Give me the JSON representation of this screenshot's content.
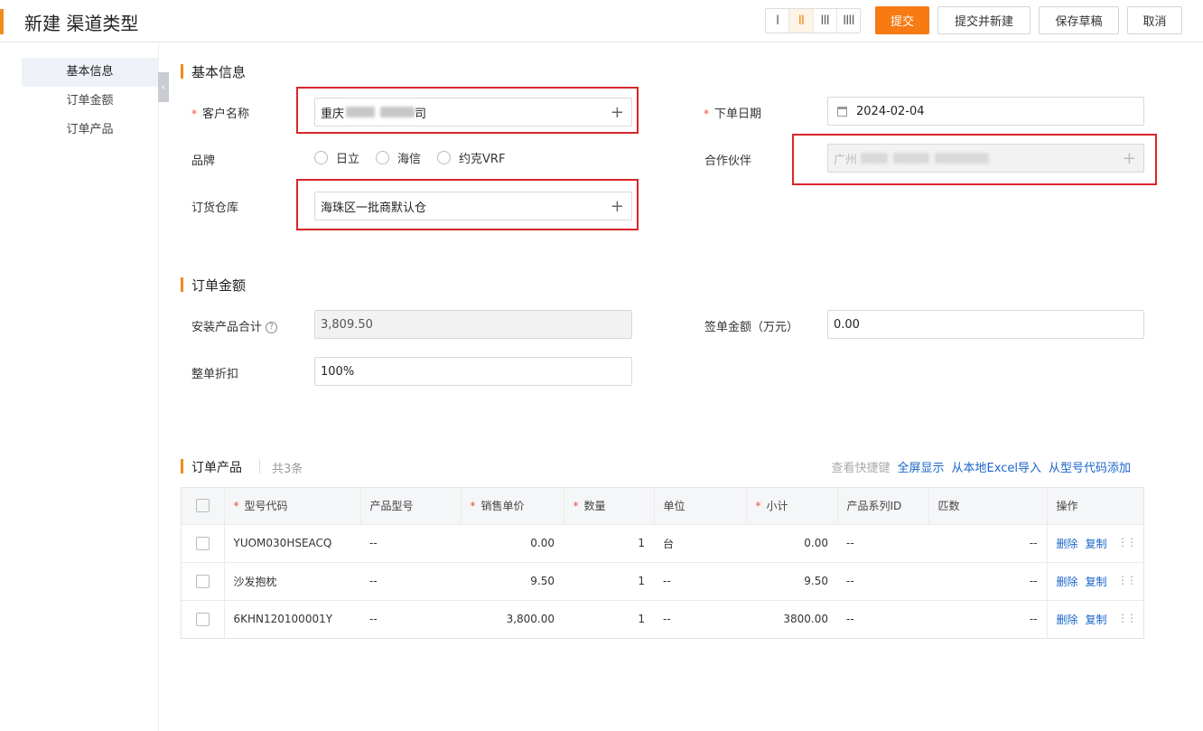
{
  "header": {
    "title": "新建 渠道类型",
    "layout_options": [
      "I",
      "II",
      "III",
      "IIII"
    ],
    "active_layout": 1,
    "buttons": {
      "submit": "提交",
      "submit_new": "提交并新建",
      "save_draft": "保存草稿",
      "cancel": "取消"
    }
  },
  "sidebar": {
    "items": [
      "基本信息",
      "订单金额",
      "订单产品"
    ],
    "active": 0
  },
  "basic": {
    "title": "基本信息",
    "customer": {
      "label": "客户名称",
      "value": "重庆",
      "value_tail": "司"
    },
    "order_date": {
      "label": "下单日期",
      "value": "2024-02-04"
    },
    "brand": {
      "label": "品牌",
      "options": [
        "日立",
        "海信",
        "约克VRF"
      ]
    },
    "partner": {
      "label": "合作伙伴",
      "value": "广州"
    },
    "warehouse": {
      "label": "订货仓库",
      "value": "海珠区一批商默认仓"
    }
  },
  "amount": {
    "title": "订单金额",
    "install_total": {
      "label": "安装产品合计",
      "value": "3,809.50"
    },
    "sign_amount": {
      "label": "签单金额（万元）",
      "value": "0.00"
    },
    "discount": {
      "label": "整单折扣",
      "value": "100%"
    }
  },
  "products": {
    "title": "订单产品",
    "count": "共3条",
    "links": {
      "shortcut": "查看快捷键",
      "fullscreen": "全屏显示",
      "excel": "从本地Excel导入",
      "model": "从型号代码添加"
    },
    "columns": [
      "型号代码",
      "产品型号",
      "销售单价",
      "数量",
      "单位",
      "小计",
      "产品系列ID",
      "匹数",
      "操作"
    ],
    "rows": [
      {
        "code": "YUOM030HSEACQ",
        "model": "--",
        "price": "0.00",
        "qty": "1",
        "unit": "台",
        "subtotal": "0.00",
        "series": "--",
        "hp": "--"
      },
      {
        "code": "沙发抱枕",
        "model": "--",
        "price": "9.50",
        "qty": "1",
        "unit": "--",
        "subtotal": "9.50",
        "series": "--",
        "hp": "--"
      },
      {
        "code": "6KHN120100001Y",
        "model": "--",
        "price": "3,800.00",
        "qty": "1",
        "unit": "--",
        "subtotal": "3800.00",
        "series": "--",
        "hp": "--"
      }
    ],
    "ops": {
      "delete": "删除",
      "copy": "复制"
    }
  },
  "colors": {
    "accent": "#f08c1c",
    "primary_button": "#f77a13",
    "link": "#1a66c9",
    "highlight_box": "#d9252a"
  }
}
